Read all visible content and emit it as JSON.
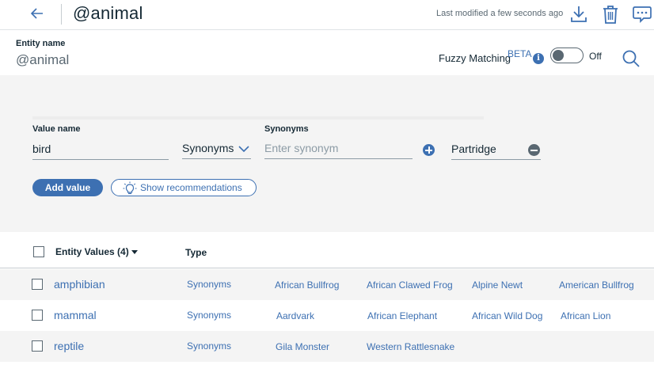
{
  "header": {
    "title": "@animal",
    "last_modified": "Last modified a few seconds ago"
  },
  "entity": {
    "name_label": "Entity name",
    "name_value": "@animal",
    "fuzzy_label": "Fuzzy Matching",
    "fuzzy_badge": "BETA",
    "fuzzy_info": "i",
    "fuzzy_state": "Off"
  },
  "value_form": {
    "value_name_label": "Value name",
    "value_name": "bird",
    "synonyms_label": "Synonyms",
    "type_select": "Synonyms",
    "synonym_placeholder": "Enter synonym",
    "existing_synonym": "Partridge",
    "add_value_button": "Add value",
    "recommendations_button": "Show recommendations"
  },
  "table": {
    "col_values": "Entity Values (4)",
    "col_type": "Type",
    "rows": [
      {
        "value": "amphibian",
        "type": "Synonyms",
        "synonyms": [
          "African Bullfrog",
          "African Clawed Frog",
          "Alpine Newt",
          "American Bullfrog"
        ]
      },
      {
        "value": "mammal",
        "type": "Synonyms",
        "synonyms": [
          "Aardvark",
          "African Elephant",
          "African Wild Dog",
          "African Lion"
        ]
      },
      {
        "value": "reptile",
        "type": "Synonyms",
        "synonyms": [
          "Gila Monster",
          "Western Rattlesnake"
        ]
      }
    ]
  },
  "colors": {
    "accent": "#3d70b2",
    "text": "#152935",
    "muted": "#5a6872",
    "panel": "#f4f4f4"
  },
  "icons": [
    "arrow-left-icon",
    "download-icon",
    "trash-icon",
    "chat-icon",
    "info-icon",
    "search-icon",
    "chevron-down-icon",
    "add-icon",
    "remove-icon",
    "lightbulb-icon",
    "sort-caret-icon"
  ]
}
